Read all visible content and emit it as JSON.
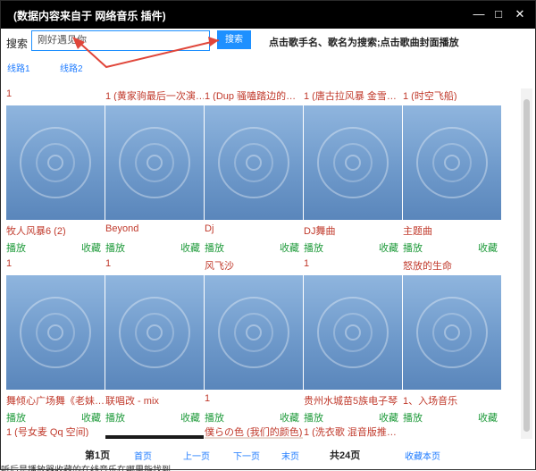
{
  "window": {
    "title": "(数据内容来自于 网络音乐 插件)"
  },
  "search": {
    "label": "搜索",
    "value": "刚好遇见你",
    "button": "搜索",
    "hint": "点击歌手名、歌名为搜索;点击歌曲封面播放"
  },
  "routes": [
    "线路1",
    "线路2"
  ],
  "actions": {
    "play": "播放",
    "fav": "收藏"
  },
  "rows": [
    [
      {
        "top": "1",
        "name": "牧人风暴6 (2)"
      },
      {
        "top": "1 (黄家驹最后一次演…",
        "name": "Beyond"
      },
      {
        "top": "1 (Dup 骚嗑踏边的…",
        "name": "Dj"
      },
      {
        "top": "1 (唐古拉风暴 金雪…",
        "name": "DJ舞曲"
      },
      {
        "top": "1 (时空飞船)",
        "name": "主题曲"
      }
    ],
    [
      {
        "top": "1",
        "name": "舞倾心广场舞《老妹…"
      },
      {
        "top": "1",
        "name": "联唱改 - mix"
      },
      {
        "top": "风飞沙",
        "name": "1"
      },
      {
        "top": "1",
        "name": "贵州水城苗5族电子琴"
      },
      {
        "top": "怒放的生命",
        "name": "1、入场音乐"
      }
    ],
    [
      {
        "top": "1 (号女麦 Qq 空间)"
      },
      {
        "top": ""
      },
      {
        "top": "僕らの色 (我们的颜色)"
      },
      {
        "top": "1 (洗衣歌 混音版推…"
      },
      {
        "top": ""
      }
    ]
  ],
  "pager": {
    "current": "第1页",
    "first": "首页",
    "prev": "上一页",
    "next": "下一页",
    "last": "末页",
    "total": "共24页",
    "favpage": "收藏本页"
  },
  "footer_note": "听后是播放器收藏的在线音乐在哪里能找到"
}
